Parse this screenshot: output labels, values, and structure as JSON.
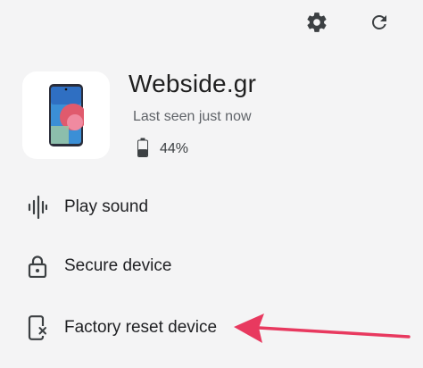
{
  "toolbar": {
    "settings_icon": "gear-icon",
    "refresh_icon": "refresh-icon"
  },
  "device": {
    "name": "Webside.gr",
    "status": "Last seen just now",
    "battery_percent_label": "44%",
    "battery_level": 0.44,
    "image": "phone-image"
  },
  "actions": [
    {
      "label": "Play sound",
      "icon": "sound-wave-icon"
    },
    {
      "label": "Secure device",
      "icon": "lock-icon"
    },
    {
      "label": "Factory reset device",
      "icon": "phone-erase-icon"
    }
  ],
  "annotation": {
    "arrow_color": "#e8395f"
  }
}
